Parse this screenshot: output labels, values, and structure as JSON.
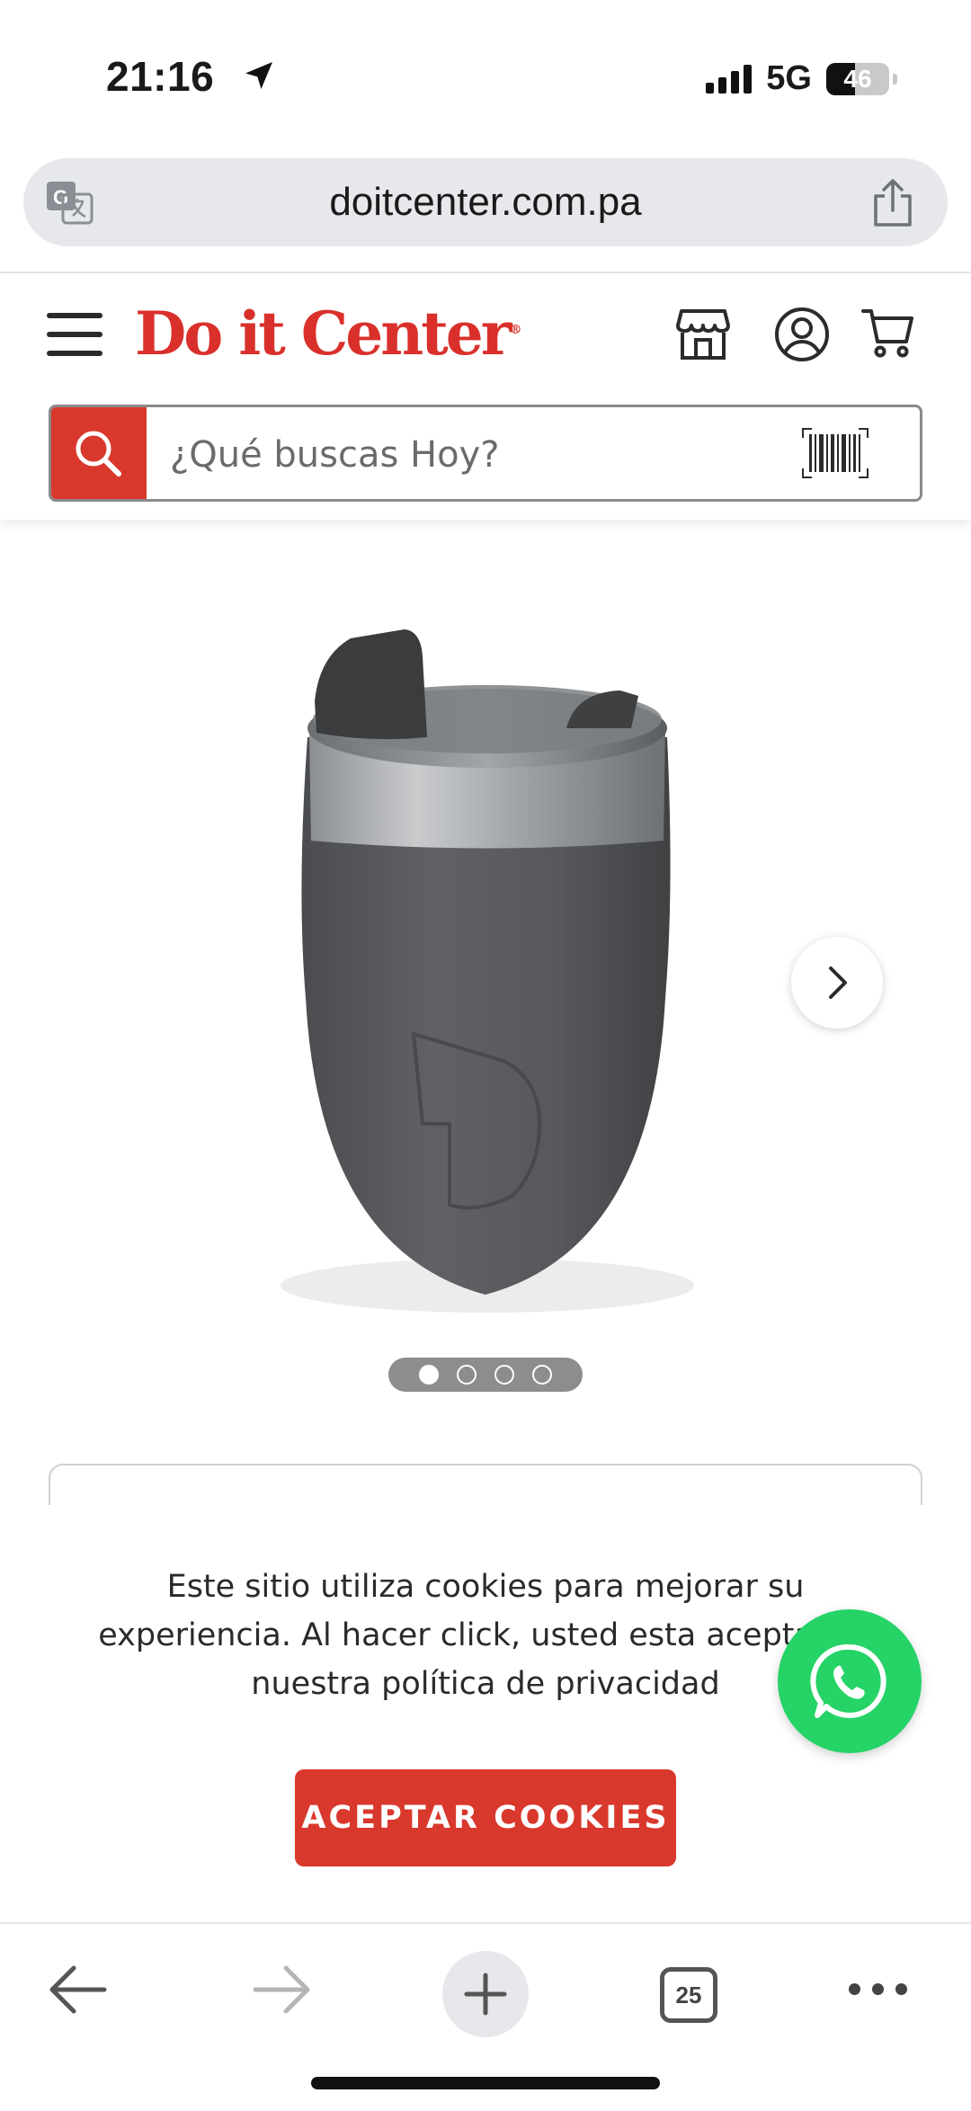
{
  "status_bar": {
    "time": "21:16",
    "network": "5G",
    "battery": "46"
  },
  "browser": {
    "url": "doitcenter.com.pa",
    "tab_count": "25"
  },
  "header": {
    "logo_text": "Do it Center",
    "logo_mark": "®",
    "search_placeholder": "¿Qué buscas Hoy?"
  },
  "carousel": {
    "slide_count": 4,
    "active_index": 0
  },
  "cookie_banner": {
    "message": "Este sitio utiliza cookies para mejorar su experiencia. Al hacer click, usted esta aceptando nuestra política de privacidad",
    "accept_label": "ACEPTAR COOKIES"
  },
  "colors": {
    "brand_red": "#d9302b",
    "whatsapp_green": "#25d366"
  }
}
